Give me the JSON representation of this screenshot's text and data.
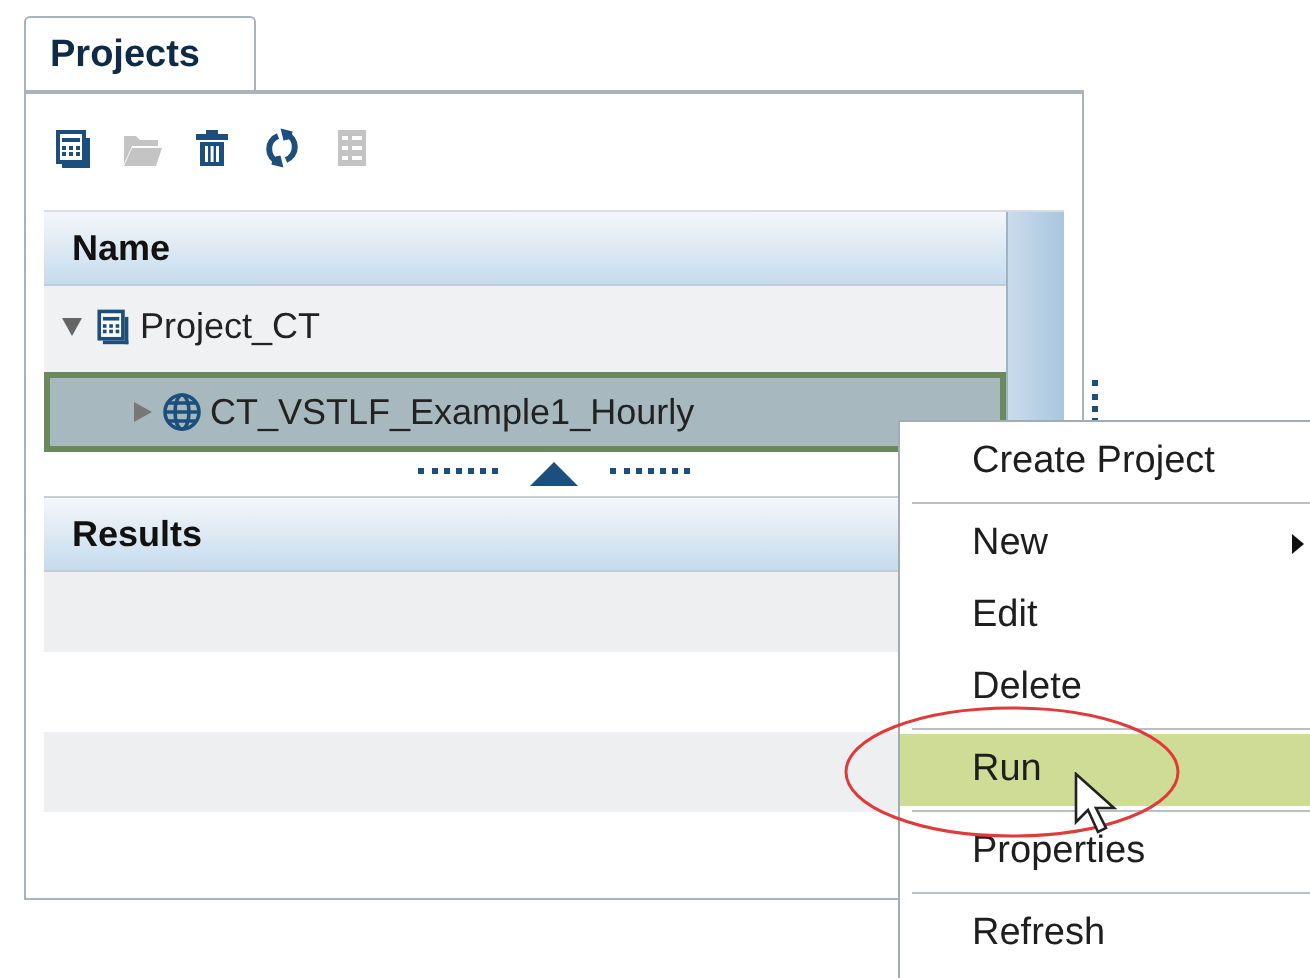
{
  "tabs": [
    {
      "label": "Projects",
      "selected": true
    }
  ],
  "toolbar": [
    {
      "kind": "project",
      "disabled": false
    },
    {
      "kind": "folder",
      "disabled": true
    },
    {
      "kind": "trash",
      "disabled": false
    },
    {
      "kind": "refresh",
      "disabled": false
    },
    {
      "kind": "list",
      "disabled": true
    }
  ],
  "tree": {
    "header": "Name",
    "items": [
      {
        "label": "Project_CT",
        "kind": "project",
        "expanded": true,
        "selected": false,
        "children": [
          {
            "label": "CT_VSTLF_Example1_Hourly",
            "kind": "globe",
            "expanded": false,
            "selected": true
          }
        ]
      }
    ]
  },
  "results": {
    "header": "Results"
  },
  "context_menu": [
    {
      "kind": "item",
      "label": "Create Project",
      "selected": false,
      "submenu": false
    },
    {
      "kind": "separator"
    },
    {
      "kind": "item",
      "label": "New",
      "selected": false,
      "submenu": true
    },
    {
      "kind": "item",
      "label": "Edit",
      "selected": false,
      "submenu": false
    },
    {
      "kind": "item",
      "label": "Delete",
      "selected": false,
      "submenu": false
    },
    {
      "kind": "separator"
    },
    {
      "kind": "item",
      "label": "Run",
      "selected": true,
      "submenu": false
    },
    {
      "kind": "separator"
    },
    {
      "kind": "item",
      "label": "Properties",
      "selected": false,
      "submenu": false
    },
    {
      "kind": "separator"
    },
    {
      "kind": "item",
      "label": "Refresh",
      "selected": false,
      "submenu": false
    }
  ]
}
